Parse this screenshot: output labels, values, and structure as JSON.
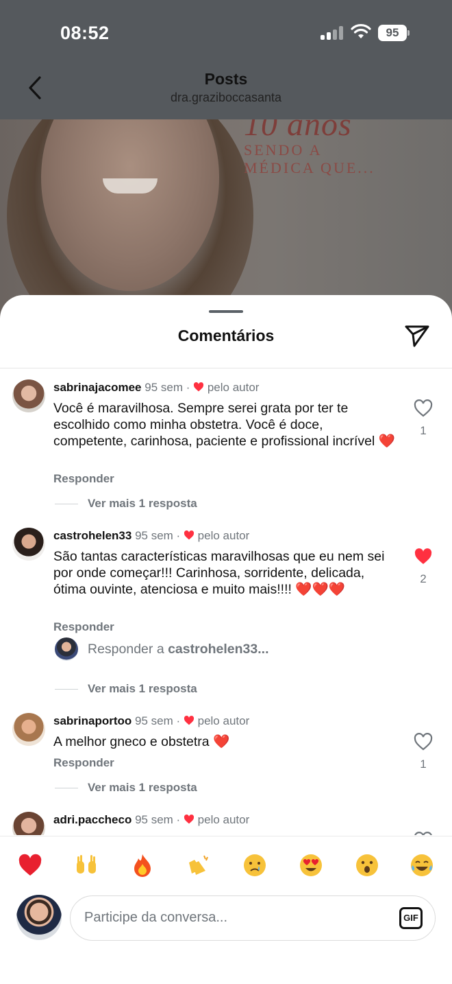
{
  "status_bar": {
    "time": "08:52",
    "battery": "95"
  },
  "nav": {
    "title": "Posts",
    "subtitle": "dra.graziboccasanta"
  },
  "post_overlay": {
    "line_big": "10 anos",
    "line1": "SENDO A",
    "line2": "MÉDICA QUE..."
  },
  "sheet": {
    "title": "Comentários"
  },
  "comments": [
    {
      "username": "sabrinajacomee",
      "time": "95 sem",
      "author_like": "pelo autor",
      "text": "Você é maravilhosa. Sempre serei grata por ter te escolhido como minha obstetra. Você é doce, competente, carinhosa, paciente e profissional incrível ❤️",
      "reply_label": "Responder",
      "likes": "1",
      "liked": false,
      "more_replies": "Ver mais 1 resposta"
    },
    {
      "username": "castrohelen33",
      "time": "95 sem",
      "author_like": "pelo autor",
      "text": "São tantas características maravilhosas que eu nem sei por onde começar!!! Carinhosa, sorridente, delicada, ótima ouvinte, atenciosa e muito mais!!!! ❤️❤️❤️",
      "reply_label": "Responder",
      "likes": "2",
      "liked": true,
      "reply_to_prefix": "Responder a ",
      "reply_to_user": "castrohelen33...",
      "more_replies": "Ver mais 1 resposta"
    },
    {
      "username": "sabrinaportoo",
      "time": "95 sem",
      "author_like": "pelo autor",
      "text": "A melhor gneco e obstetra ❤️",
      "reply_label": "Responder",
      "likes": "1",
      "liked": false,
      "more_replies": "Ver mais 1 resposta"
    },
    {
      "username": "adri.paccheco",
      "time": "95 sem",
      "author_like": "pelo autor"
    }
  ],
  "quick_reactions": [
    "red-heart",
    "raising-hands",
    "fire",
    "clapping-hands",
    "crying-face",
    "heart-eyes-face",
    "astonished-face",
    "tears-of-joy-face"
  ],
  "composer": {
    "placeholder": "Participe da conversa...",
    "gif_label": "GIF"
  },
  "colors": {
    "like_red": "#ff3040",
    "muted_text": "#6f757b",
    "dim_overlay": "#55595d"
  }
}
